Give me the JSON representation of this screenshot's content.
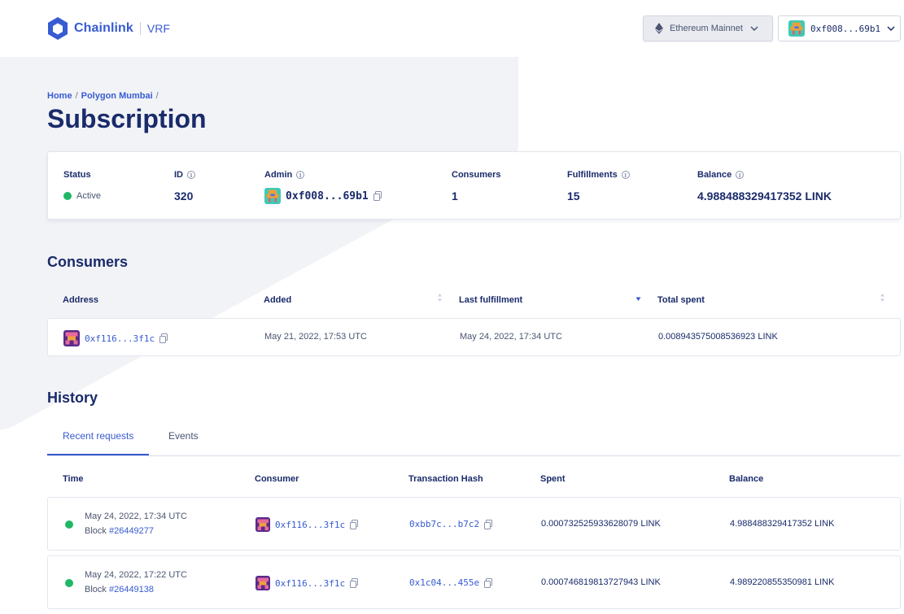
{
  "header": {
    "brand": "Chainlink",
    "product": "VRF",
    "network": "Ethereum Mainnet",
    "account": "0xf008...69b1"
  },
  "breadcrumb": {
    "home": "Home",
    "network": "Polygon Mumbai",
    "sep": "/"
  },
  "page_title": "Subscription",
  "summary": {
    "status_label": "Status",
    "status_value": "Active",
    "id_label": "ID",
    "id_value": "320",
    "admin_label": "Admin",
    "admin_value": "0xf008...69b1",
    "consumers_label": "Consumers",
    "consumers_value": "1",
    "fulfillments_label": "Fulfillments",
    "fulfillments_value": "15",
    "balance_label": "Balance",
    "balance_value": "4.988488329417352 LINK"
  },
  "consumers": {
    "title": "Consumers",
    "columns": [
      "Address",
      "Added",
      "Last fulfillment",
      "Total spent"
    ],
    "rows": [
      {
        "address": "0xf116...3f1c",
        "added": "May 21, 2022, 17:53 UTC",
        "last_fulfillment": "May 24, 2022, 17:34 UTC",
        "total_spent": "0.008943575008536923 LINK"
      }
    ]
  },
  "history": {
    "title": "History",
    "tabs": [
      "Recent requests",
      "Events"
    ],
    "columns": [
      "Time",
      "Consumer",
      "Transaction Hash",
      "Spent",
      "Balance"
    ],
    "block_label": "Block",
    "rows": [
      {
        "time": "May 24, 2022, 17:34 UTC",
        "block": "#26449277",
        "consumer": "0xf116...3f1c",
        "tx_hash": "0xbb7c...b7c2",
        "spent": "0.000732525933628079 LINK",
        "balance": "4.988488329417352 LINK"
      },
      {
        "time": "May 24, 2022, 17:22 UTC",
        "block": "#26449138",
        "consumer": "0xf116...3f1c",
        "tx_hash": "0x1c04...455e",
        "spent": "0.000746819813727943 LINK",
        "balance": "4.989220855350981 LINK"
      }
    ]
  },
  "colors": {
    "brand": "#375bd2",
    "text_dark": "#1a2b6b",
    "active": "#1fb866",
    "background_shape": "#f2f3f6"
  },
  "icons": [
    "chainlink-hex-logo",
    "ethereum-icon",
    "chevron-down-icon",
    "info-icon",
    "copy-icon",
    "sort-icon",
    "sort-desc-icon",
    "identicon-avatar"
  ]
}
